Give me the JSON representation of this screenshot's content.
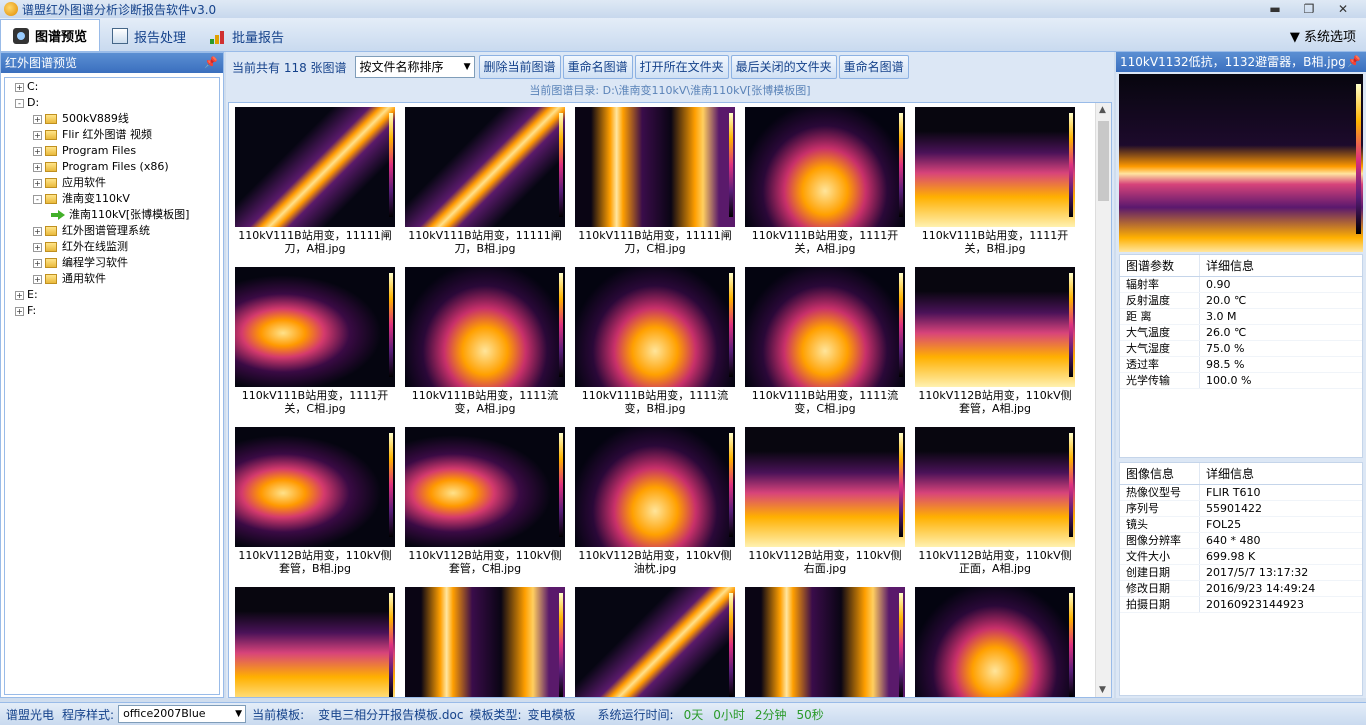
{
  "app": {
    "title": "谱盟红外图谱分析诊断报告软件v3.0"
  },
  "tabs": [
    {
      "label": "图谱预览"
    },
    {
      "label": "报告处理"
    },
    {
      "label": "批量报告"
    }
  ],
  "system_options": "系统选项",
  "left_panel": {
    "title": "红外图谱预览",
    "tree": [
      {
        "label": "C:",
        "depth": 0,
        "expand": "+"
      },
      {
        "label": "D:",
        "depth": 0,
        "expand": "-"
      },
      {
        "label": "500kV889线",
        "depth": 1,
        "expand": "+"
      },
      {
        "label": "Flir 红外图谱  视频",
        "depth": 1,
        "expand": "+"
      },
      {
        "label": "Program Files",
        "depth": 1,
        "expand": "+"
      },
      {
        "label": "Program Files (x86)",
        "depth": 1,
        "expand": "+"
      },
      {
        "label": "应用软件",
        "depth": 1,
        "expand": "+"
      },
      {
        "label": "淮南变110kV",
        "depth": 1,
        "expand": "-"
      },
      {
        "label": "淮南110kV[张博模板图]",
        "depth": 2,
        "expand": ""
      },
      {
        "label": "红外图谱管理系统",
        "depth": 1,
        "expand": "+"
      },
      {
        "label": "红外在线监测",
        "depth": 1,
        "expand": "+"
      },
      {
        "label": "编程学习软件",
        "depth": 1,
        "expand": "+"
      },
      {
        "label": "通用软件",
        "depth": 1,
        "expand": "+"
      },
      {
        "label": "E:",
        "depth": 0,
        "expand": "+"
      },
      {
        "label": "F:",
        "depth": 0,
        "expand": "+"
      }
    ]
  },
  "toolbar": {
    "count_text": "当前共有  118  张图谱",
    "sort_select": "按文件名称排序",
    "buttons": [
      "删除当前图谱",
      "重命名图谱",
      "打开所在文件夹",
      "最后关闭的文件夹",
      "重命名图谱"
    ],
    "dir_text": "当前图谱目录:  D:\\淮南变110kV\\淮南110kV[张博模板图]"
  },
  "gallery": [
    {
      "caption": "110kV111B站用变，11111闸刀，A相.jpg"
    },
    {
      "caption": "110kV111B站用变，11111闸刀，B相.jpg"
    },
    {
      "caption": "110kV111B站用变，11111闸刀，C相.jpg"
    },
    {
      "caption": "110kV111B站用变，1111开关，A相.jpg"
    },
    {
      "caption": "110kV111B站用变，1111开关，B相.jpg"
    },
    {
      "caption": "110kV111B站用变，1111开关，C相.jpg"
    },
    {
      "caption": "110kV111B站用变，1111流变，A相.jpg"
    },
    {
      "caption": "110kV111B站用变，1111流变，B相.jpg"
    },
    {
      "caption": "110kV111B站用变，1111流变，C相.jpg"
    },
    {
      "caption": "110kV112B站用变，110kV侧套管，A相.jpg"
    },
    {
      "caption": "110kV112B站用变，110kV侧套管，B相.jpg"
    },
    {
      "caption": "110kV112B站用变，110kV侧套管，C相.jpg"
    },
    {
      "caption": "110kV112B站用变，110kV侧油枕.jpg"
    },
    {
      "caption": "110kV112B站用变，110kV侧右面.jpg"
    },
    {
      "caption": "110kV112B站用变，110kV侧正面，A相.jpg"
    },
    {
      "caption": ""
    },
    {
      "caption": ""
    },
    {
      "caption": ""
    },
    {
      "caption": ""
    },
    {
      "caption": ""
    }
  ],
  "right_panel": {
    "title": "110kV1132低抗，1132避雷器，B相.jpg",
    "params": {
      "header_k": "图谱参数",
      "header_v": "详细信息",
      "rows": [
        [
          "辐射率",
          "0.90"
        ],
        [
          "反射温度",
          "20.0 ℃"
        ],
        [
          "距  离",
          "3.0 M"
        ],
        [
          "大气温度",
          "26.0 ℃"
        ],
        [
          "大气湿度",
          "75.0 %"
        ],
        [
          "透过率",
          "98.5 %"
        ],
        [
          "光学传输",
          "100.0 %"
        ]
      ]
    },
    "image_info": {
      "header_k": "图像信息",
      "header_v": "详细信息",
      "rows": [
        [
          "热像仪型号",
          "FLIR T610"
        ],
        [
          "序列号",
          "55901422"
        ],
        [
          "镜头",
          "FOL25"
        ],
        [
          "图像分辨率",
          "640 * 480"
        ],
        [
          "文件大小",
          "699.98 K"
        ],
        [
          "创建日期",
          "2017/5/7 13:17:32"
        ],
        [
          "修改日期",
          "2016/9/23 14:49:24"
        ],
        [
          "拍摄日期",
          "20160923144923"
        ]
      ]
    }
  },
  "status": {
    "brand": "谱盟光电",
    "style_label": "程序样式:",
    "style_value": "office2007Blue",
    "template_label": "当前模板:",
    "template_value": "变电三相分开报告模板.doc",
    "type_label": "模板类型:",
    "type_value": "变电模板",
    "runtime_label": "系统运行时间:",
    "d": "0天",
    "h": "0小时",
    "m": "2分钟",
    "s": "50秒"
  }
}
